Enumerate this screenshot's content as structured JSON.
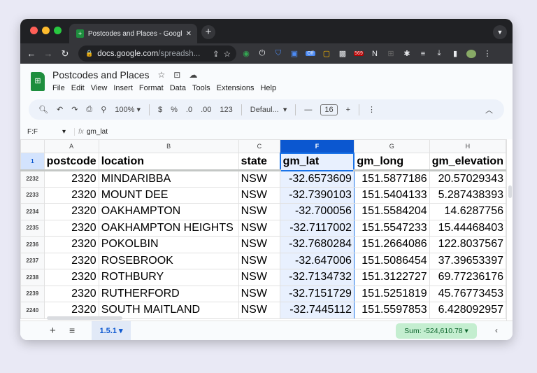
{
  "browser": {
    "tab_title": "Postcodes and Places - Google",
    "url_host": "docs.google.com",
    "url_path": "/spreadsh...",
    "ext_badges": [
      "Off",
      "569"
    ]
  },
  "doc": {
    "title": "Postcodes and Places",
    "menu": [
      "File",
      "Edit",
      "View",
      "Insert",
      "Format",
      "Data",
      "Tools",
      "Extensions",
      "Help"
    ]
  },
  "toolbar": {
    "zoom": "100%",
    "currency": "$",
    "percent": "%",
    "dec_dec": ".0",
    "inc_dec": ".00",
    "format_123": "123",
    "font": "Defaul...",
    "font_size": "16"
  },
  "formula_bar": {
    "name_box": "F:F",
    "fx": "fx",
    "content": "gm_lat"
  },
  "grid": {
    "col_letters": [
      "A",
      "B",
      "C",
      "F",
      "G",
      "H"
    ],
    "header_row_num": "1",
    "headers": [
      "postcode",
      "location",
      "state",
      "gm_lat",
      "gm_long",
      "gm_elevation"
    ],
    "rows": [
      {
        "n": "2232",
        "c": [
          "2320",
          "MINDARIBBA",
          "NSW",
          "-32.6573609",
          "151.5877186",
          "20.57029343"
        ]
      },
      {
        "n": "2233",
        "c": [
          "2320",
          "MOUNT DEE",
          "NSW",
          "-32.7390103",
          "151.5404133",
          "5.287438393"
        ]
      },
      {
        "n": "2234",
        "c": [
          "2320",
          "OAKHAMPTON",
          "NSW",
          "-32.700056",
          "151.5584204",
          "14.6287756"
        ]
      },
      {
        "n": "2235",
        "c": [
          "2320",
          "OAKHAMPTON HEIGHTS",
          "NSW",
          "-32.7117002",
          "151.5547233",
          "15.44468403"
        ]
      },
      {
        "n": "2236",
        "c": [
          "2320",
          "POKOLBIN",
          "NSW",
          "-32.7680284",
          "151.2664086",
          "122.8037567"
        ]
      },
      {
        "n": "2237",
        "c": [
          "2320",
          "ROSEBROOK",
          "NSW",
          "-32.647006",
          "151.5086454",
          "37.39653397"
        ]
      },
      {
        "n": "2238",
        "c": [
          "2320",
          "ROTHBURY",
          "NSW",
          "-32.7134732",
          "151.3122727",
          "69.77236176"
        ]
      },
      {
        "n": "2239",
        "c": [
          "2320",
          "RUTHERFORD",
          "NSW",
          "-32.7151729",
          "151.5251819",
          "45.76773453"
        ]
      },
      {
        "n": "2240",
        "c": [
          "2320",
          "SOUTH MAITLAND",
          "NSW",
          "-32.7445112",
          "151.5597853",
          "6.428092957"
        ]
      }
    ]
  },
  "bottom": {
    "sheet_tab": "1.5.1",
    "sum": "Sum: -524,610.78"
  },
  "colors": {
    "accent": "#0b57d0",
    "selection": "#e8f0fe",
    "sum_bg": "#c4eed0"
  }
}
